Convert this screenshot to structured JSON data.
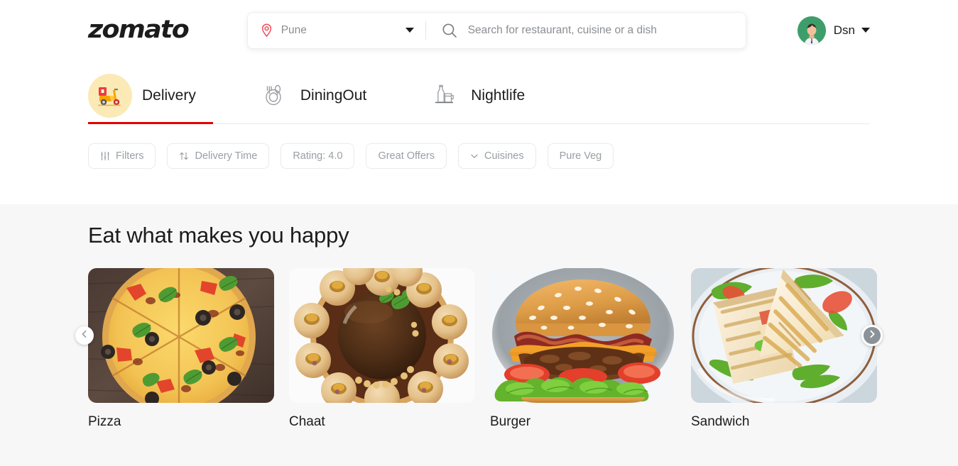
{
  "header": {
    "logo": "zomato",
    "location": {
      "value": "Pune",
      "icon": "location-pin-icon"
    },
    "search": {
      "placeholder": "Search for restaurant, cuisine or a dish",
      "value": "",
      "icon": "search-icon"
    },
    "user": {
      "name": "Dsn",
      "avatar_icon": "user-avatar",
      "caret_icon": "chevron-down-icon"
    }
  },
  "tabs": {
    "active": "Delivery",
    "items": [
      {
        "label": "Delivery",
        "icon": "scooter-icon",
        "active": true
      },
      {
        "label": "DiningOut",
        "icon": "dining-cutlery-icon",
        "active": false
      },
      {
        "label": "Nightlife",
        "icon": "bottle-mug-icon",
        "active": false
      }
    ]
  },
  "filters": {
    "chips": [
      {
        "label": "Filters",
        "icon": "sliders-icon"
      },
      {
        "label": "Delivery Time",
        "icon": "sort-arrows-icon"
      },
      {
        "label": "Rating: 4.0",
        "icon": ""
      },
      {
        "label": "Great Offers",
        "icon": ""
      },
      {
        "label": "Cuisines",
        "icon": "chevron-down-icon"
      },
      {
        "label": "Pure Veg",
        "icon": ""
      }
    ]
  },
  "main": {
    "section_title": "Eat what makes you happy",
    "carousel": {
      "prev_icon": "chevron-left-icon",
      "next_icon": "chevron-right-icon",
      "cards": [
        {
          "label": "Pizza",
          "image": "sliced-pizza-photo"
        },
        {
          "label": "Chaat",
          "image": "pani-puri-photo"
        },
        {
          "label": "Burger",
          "image": "cheeseburger-photo"
        },
        {
          "label": "Sandwich",
          "image": "grilled-sandwich-photo"
        }
      ]
    }
  },
  "colors": {
    "brand_red": "#e40000",
    "accent_yellow": "#fbe9b6",
    "page_bg": "#f7f7f7",
    "text_primary": "#1c1c1c",
    "text_muted": "#9a9ea3"
  }
}
